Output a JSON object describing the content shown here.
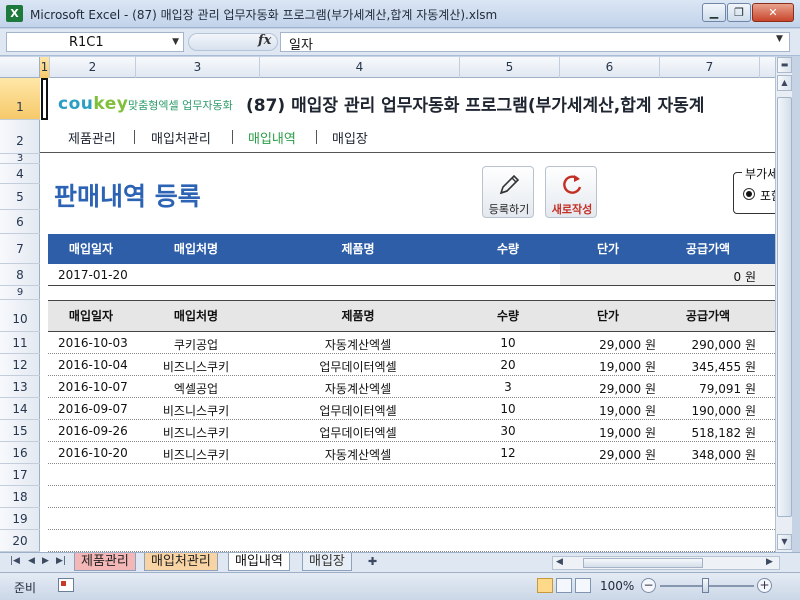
{
  "window": {
    "title": "Microsoft Excel - (87) 매입장 관리 업무자동화 프로그램(부가세계산,합계 자동계산).xlsm",
    "app_icon": "X",
    "minimize": "▁",
    "maximize": "❐",
    "close": "✕"
  },
  "formula_bar": {
    "name_box": "R1C1",
    "fx": "fx",
    "value": "일자"
  },
  "columns": [
    "1",
    "2",
    "3",
    "4",
    "5",
    "6",
    "7"
  ],
  "rows": [
    "1",
    "2",
    "3",
    "4",
    "5",
    "6",
    "7",
    "8",
    "9",
    "10",
    "11",
    "12",
    "13",
    "14",
    "15",
    "16",
    "17",
    "18",
    "19",
    "20"
  ],
  "header": {
    "logo_main": "cou",
    "logo_accent": "key",
    "logo_sub": "맞춤형엑셀 업무자동화",
    "doc_title": "(87) 매입장 관리 업무자동화 프로그램(부가세계산,합계 자동계"
  },
  "nav": {
    "items": [
      {
        "label": "제품관리"
      },
      {
        "label": "매입처관리"
      },
      {
        "label": "매입내역"
      },
      {
        "label": "매입장"
      }
    ],
    "active": "매입내역"
  },
  "section_title": "판매내역 등록",
  "buttons": {
    "register": "등록하기",
    "new": "새로작성"
  },
  "vat": {
    "legend": "부가세",
    "option": "포함"
  },
  "input_table": {
    "headers": [
      "매입일자",
      "매입처명",
      "제품명",
      "수량",
      "단가",
      "공급가액"
    ],
    "row": {
      "date": "2017-01-20",
      "amount": "0 원"
    }
  },
  "list_table": {
    "headers": [
      "매입일자",
      "매입처명",
      "제품명",
      "수량",
      "단가",
      "공급가액"
    ],
    "rows": [
      {
        "date": "2016-10-03",
        "vendor": "쿠키공업",
        "product": "자동계산엑셀",
        "qty": "10",
        "price": "29,000 원",
        "amount": "290,000 원"
      },
      {
        "date": "2016-10-04",
        "vendor": "비즈니스쿠키",
        "product": "업무데이터엑셀",
        "qty": "20",
        "price": "19,000 원",
        "amount": "345,455 원"
      },
      {
        "date": "2016-10-07",
        "vendor": "엑셀공업",
        "product": "자동계산엑셀",
        "qty": "3",
        "price": "29,000 원",
        "amount": "79,091 원"
      },
      {
        "date": "2016-09-07",
        "vendor": "비즈니스쿠키",
        "product": "업무데이터엑셀",
        "qty": "10",
        "price": "19,000 원",
        "amount": "190,000 원"
      },
      {
        "date": "2016-09-26",
        "vendor": "비즈니스쿠키",
        "product": "업무데이터엑셀",
        "qty": "30",
        "price": "19,000 원",
        "amount": "518,182 원"
      },
      {
        "date": "2016-10-20",
        "vendor": "비즈니스쿠키",
        "product": "자동계산엑셀",
        "qty": "12",
        "price": "29,000 원",
        "amount": "348,000 원"
      }
    ]
  },
  "sheet_tabs": [
    {
      "label": "제품관리"
    },
    {
      "label": "매입처관리"
    },
    {
      "label": "매입내역"
    },
    {
      "label": "매입장"
    }
  ],
  "status": {
    "ready": "준비",
    "zoom": "100%",
    "zoom_minus": "−",
    "zoom_plus": "+"
  },
  "colors": {
    "table_header_blue": "#2e5ea8",
    "section_title_blue": "#2c63b5",
    "nav_active_green": "#29a046"
  }
}
